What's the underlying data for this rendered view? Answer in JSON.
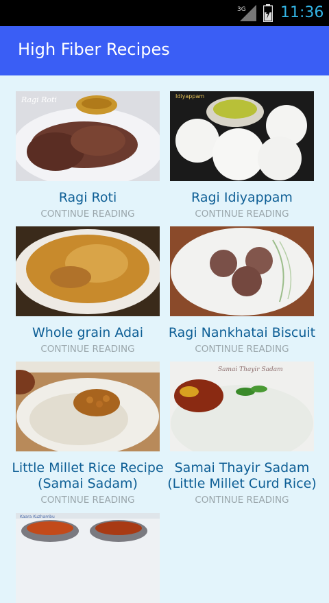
{
  "status": {
    "time": "11:36",
    "network": "3G"
  },
  "app": {
    "title": "High Fiber Recipes"
  },
  "recipes": [
    {
      "title": "Ragi Roti",
      "cta": "CONTINUE READING",
      "photo_caption": "Ragi Roti"
    },
    {
      "title": "Ragi Idiyappam",
      "cta": "CONTINUE READING",
      "photo_caption": "Idiyappam"
    },
    {
      "title": "Whole grain Adai",
      "cta": "CONTINUE READING"
    },
    {
      "title": "Ragi Nankhatai Biscuit",
      "cta": "CONTINUE READING"
    },
    {
      "title": "Little Millet Rice Recipe (Samai Sadam)",
      "cta": "CONTINUE READING"
    },
    {
      "title": "Samai Thayir Sadam (Little Millet Curd Rice)",
      "cta": "CONTINUE READING",
      "photo_caption": "Samai Thayir Sadam"
    },
    {
      "title": "",
      "cta": "",
      "photo_caption": "Kaara Kuzhambu"
    }
  ]
}
